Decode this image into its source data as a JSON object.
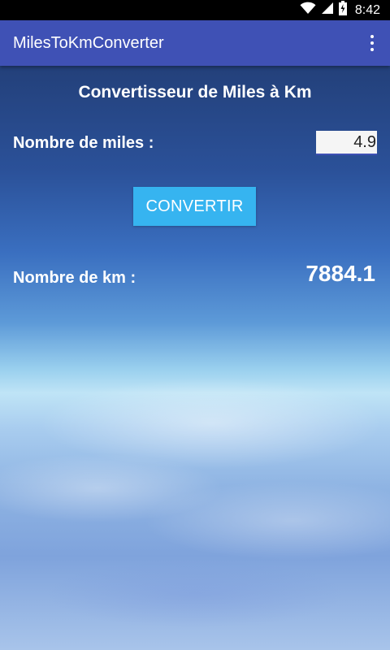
{
  "status_bar": {
    "time": "8:42",
    "icons": [
      "wifi-icon",
      "signal-icon",
      "battery-icon"
    ]
  },
  "app_bar": {
    "title": "MilesToKmConverter",
    "menu_icon": "more-vert-icon"
  },
  "main": {
    "heading": "Convertisseur de Miles à Km",
    "miles_label": "Nombre de miles :",
    "miles_value": "4.9",
    "convert_label": "CONVERTIR",
    "km_label": "Nombre de km :",
    "km_value": "7884.1"
  },
  "colors": {
    "app_bar": "#3f51b5",
    "button": "#36b4f0",
    "status_bar": "#000000"
  }
}
